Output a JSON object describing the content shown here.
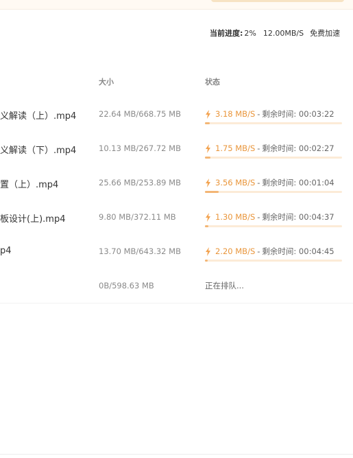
{
  "summary": {
    "label": "当前进度:",
    "percent": "2%",
    "speed": "12.00MB/S",
    "accelerate": "免费加速"
  },
  "columns": {
    "size": "大小",
    "status": "状态"
  },
  "colors": {
    "accent": "#e9953a",
    "progress_track": "#fcebd7",
    "progress_fill": "#f3b675"
  },
  "downloads": [
    {
      "name": "义解读（上）.mp4",
      "size": "22.64 MB/668.75 MB",
      "speed": "3.18 MB/S",
      "separator": "-",
      "remaining": "剩余时间: 00:03:22",
      "progress": 0.034
    },
    {
      "name": "义解读（下）.mp4",
      "size": "10.13 MB/267.72 MB",
      "speed": "1.75 MB/S",
      "separator": "-",
      "remaining": "剩余时间: 00:02:27",
      "progress": 0.038
    },
    {
      "name": "置（上）.mp4",
      "size": "25.66 MB/253.89 MB",
      "speed": "3.56 MB/S",
      "separator": "-",
      "remaining": "剩余时间: 00:01:04",
      "progress": 0.101
    },
    {
      "name": "板设计(上).mp4",
      "size": "9.80 MB/372.11 MB",
      "speed": "1.30 MB/S",
      "separator": "-",
      "remaining": "剩余时间: 00:04:37",
      "progress": 0.026
    },
    {
      "name": "p4",
      "size": "13.70 MB/643.32 MB",
      "speed": "2.20 MB/S",
      "separator": "-",
      "remaining": "剩余时间: 00:04:45",
      "progress": 0.021
    },
    {
      "name": "",
      "size": "0B/598.63 MB",
      "queued": "正在排队..."
    }
  ]
}
